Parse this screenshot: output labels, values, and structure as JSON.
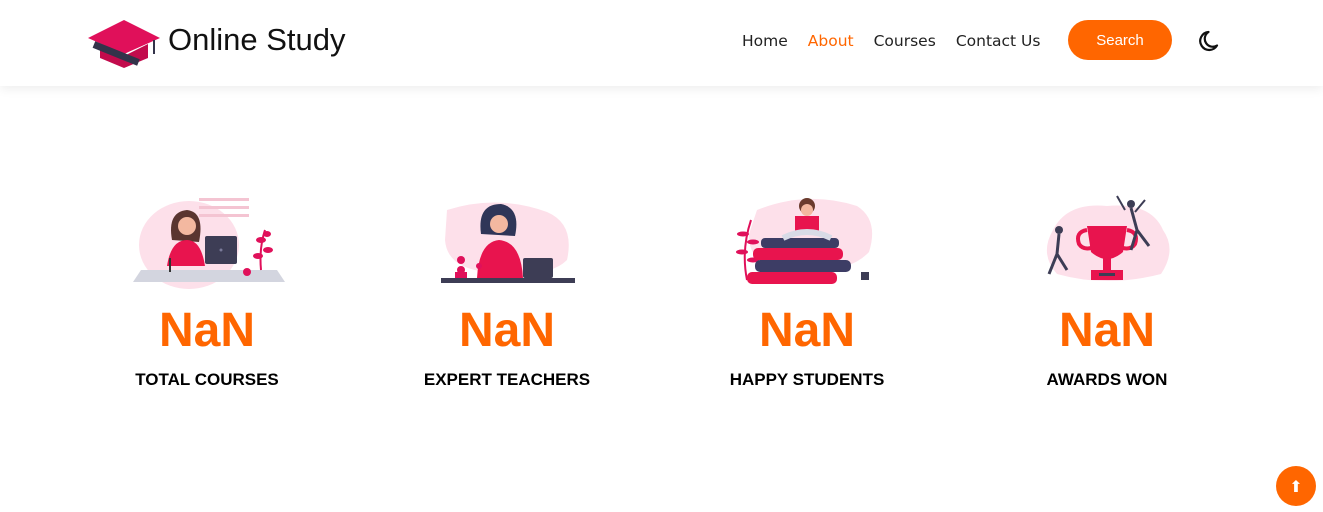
{
  "header": {
    "brand": "Online Study",
    "nav": [
      "Home",
      "About",
      "Courses",
      "Contact Us"
    ],
    "active_nav": "About",
    "search_label": "Search",
    "accent": "#ff6600",
    "theme_icon": "moon-icon"
  },
  "stats": [
    {
      "value": "NaN",
      "label": "TOTAL COURSES",
      "icon": "online-learning-illustration"
    },
    {
      "value": "NaN",
      "label": "EXPERT TEACHERS",
      "icon": "teacher-illustration"
    },
    {
      "value": "NaN",
      "label": "HAPPY STUDENTS",
      "icon": "student-reading-illustration"
    },
    {
      "value": "NaN",
      "label": "AWARDS WON",
      "icon": "trophy-illustration"
    }
  ],
  "scroll_top_icon": "arrow-up-icon",
  "scroll_top_glyph": "⬆"
}
